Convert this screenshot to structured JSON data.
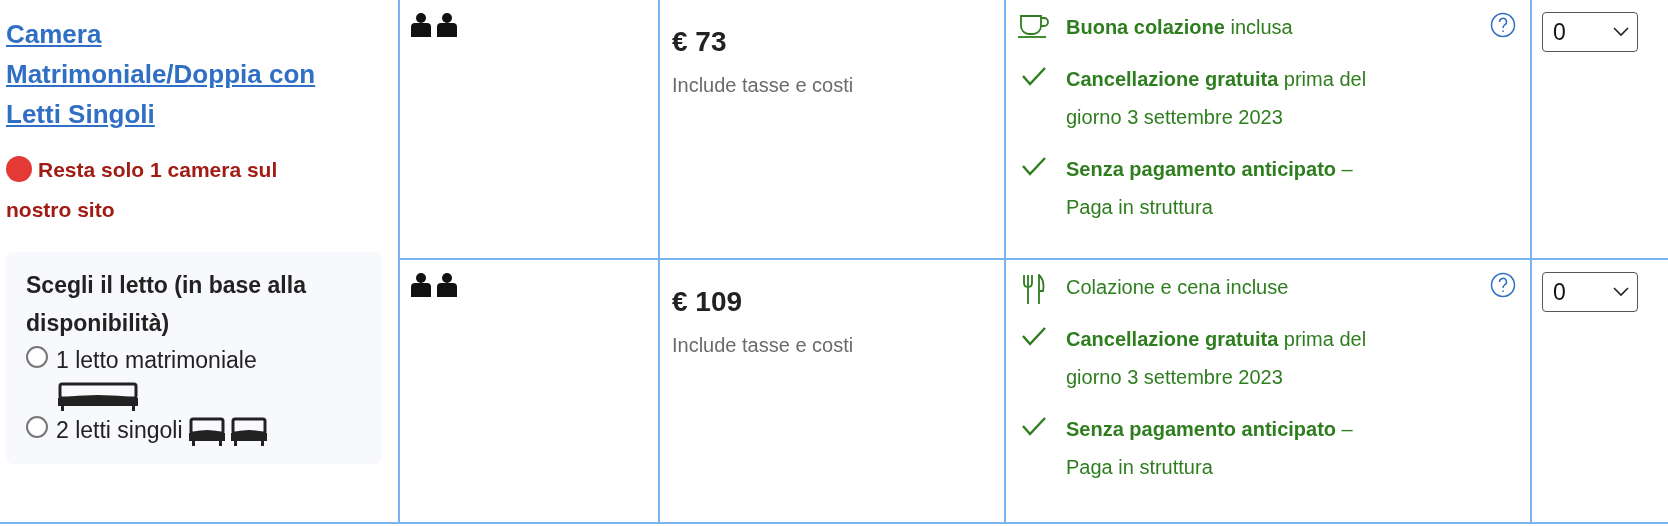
{
  "room": {
    "title": "Camera Matrimoniale/Doppia con Letti Singoli",
    "scarcity": {
      "text": "Resta solo 1 camera sul nostro sito",
      "color": "#e53935"
    },
    "bed_choice": {
      "heading": "Scegli il letto (in base alla disponibilità)",
      "options": [
        {
          "label": "1 letto matrimoniale",
          "selected": false,
          "kind": "double"
        },
        {
          "label": "2 letti singoli",
          "selected": false,
          "kind": "twin"
        }
      ]
    }
  },
  "rows": [
    {
      "price": "€ 73",
      "price_note": "Include tasse e costi",
      "conditions": [
        {
          "kind": "breakfast",
          "text": "**Buona colazione** inclusa",
          "help": true
        },
        {
          "kind": "check",
          "text": "**Cancellazione gratuita** prima del giorno 3 settembre 2023"
        },
        {
          "kind": "check",
          "text": "**Senza pagamento anticipato** – Paga in struttura"
        }
      ],
      "select_value": "0"
    },
    {
      "price": "€ 109",
      "price_note": "Include tasse e costi",
      "conditions": [
        {
          "kind": "dinner",
          "text": "Colazione e cena incluse",
          "help": true
        },
        {
          "kind": "check",
          "text": "**Cancellazione gratuita** prima del giorno 3 settembre 2023"
        },
        {
          "kind": "check",
          "text": "**Senza pagamento anticipato** – Paga in struttura"
        }
      ],
      "select_value": "0"
    }
  ]
}
